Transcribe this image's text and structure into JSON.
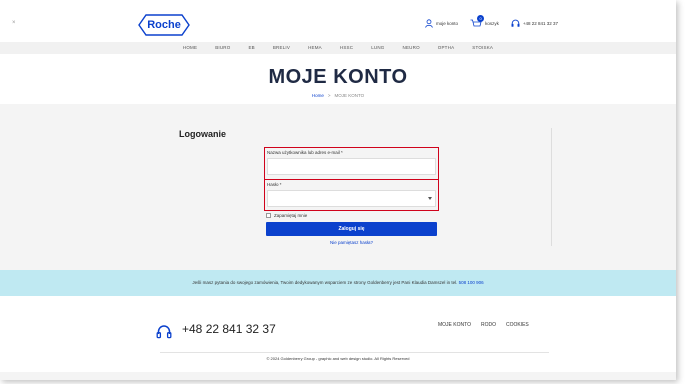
{
  "header": {
    "close_glyph": "×",
    "logo_text": "Roche",
    "account_label": "moje konto",
    "cart_label": "koszyk",
    "cart_count": "0",
    "phone": "+48 22 841 32 37"
  },
  "nav": {
    "items": [
      "HOME",
      "BIURO",
      "EB",
      "BRELIV",
      "HEMA",
      "HSSC",
      "LUNG",
      "NEURO",
      "OPTHA",
      "STOISKA"
    ]
  },
  "title": {
    "heading": "MOJE KONTO",
    "breadcrumb_home": "Home",
    "breadcrumb_sep": ">",
    "breadcrumb_current": "MOJE KONTO"
  },
  "login": {
    "heading": "Logowanie",
    "username_label": "Nazwa użytkownika lub adres e-mail *",
    "username_value": "",
    "password_label": "Hasło *",
    "password_value": "",
    "remember_label": "Zapamiętaj mnie",
    "submit_label": "Zaloguj się",
    "forgot_label": "Nie pamiętasz hasła?"
  },
  "info": {
    "text": "Jeśli masz pytania do swojego zamówienia, Twoim dedykowanym wsparciem ze strony Goldenberry jest Pani Klaudia Damszel in tel.",
    "phone": "508 100 906"
  },
  "footer": {
    "phone": "+48 22 841 32 37",
    "links": [
      "MOJE KONTO",
      "RODO",
      "COOKIES"
    ],
    "copyright": "© 2024 Goldenberry Group - graphic and web design studio. All Rights Reserved"
  },
  "colors": {
    "brand_blue": "#0b41cd",
    "highlight_red": "#d0021b",
    "info_bg": "#bfe9f2"
  }
}
